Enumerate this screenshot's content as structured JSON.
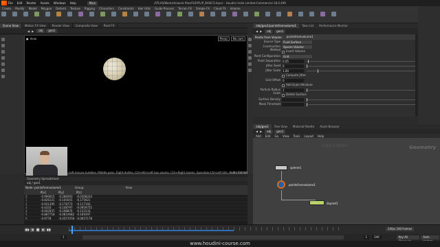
{
  "window": {
    "title": "/ATLAS/Work/sfx/work files/FLIP/FLIP_BASICS.hipnc - Houdini Indie Limited-Commercial 18.0.499",
    "menu": [
      "File",
      "Edit",
      "Render",
      "Assets",
      "Windows",
      "Help"
    ],
    "desktop": "Main"
  },
  "shelf": {
    "tabs": [
      "Create",
      "Modify",
      "Model",
      "Polygon",
      "Deform",
      "Texture",
      "Rigging",
      "Characters",
      "Constraints",
      "Hair Utils",
      "Guide Process",
      "Terrain FX",
      "Simple FX",
      "Cloud FX",
      "Volume"
    ]
  },
  "left_tabs": [
    "Scene View",
    "Motion FX View",
    "Render View",
    "Composite View",
    "Pixel FX"
  ],
  "left_path": [
    "obj",
    "geo1"
  ],
  "viewport": {
    "label": "View",
    "persp": "Persp",
    "cam": "No cam",
    "status": "Left mouse tumbles. Middle pans. Right dollies. Ctrl+Alt+Left box zooms. Ctrl+Right zooms. Spacebar-Ctrl-Left tilts. Hold L for alternate tumble, dolly, and zoom.",
    "indie": "Indie Edition"
  },
  "spreadsheet": {
    "tabs": [
      "Geometry Spreadsheet"
    ],
    "path": "obj / geo1",
    "node": "Node: pointsfromvolume1",
    "group_label": "Group:",
    "view_label": "View",
    "columns": [
      "",
      "P[x]",
      "P[y]",
      "P[z]"
    ],
    "rows": [
      [
        "0",
        "-0.999015",
        "-0.286093",
        "-0.0308224"
      ],
      [
        "1",
        "-0.826121",
        "-0.105055",
        "-0.175921"
      ],
      [
        "2",
        "-0.931395",
        "-0.178773",
        "-0.117193"
      ],
      [
        "3",
        "-0.4333",
        "-0.148797",
        "-0.0959755"
      ],
      [
        "4",
        "-0.942937",
        "-0.198876",
        "-0.133133"
      ],
      [
        "5",
        "-0.887718",
        "-0.0810682",
        "-0.169397"
      ],
      [
        "6",
        "-0.9778",
        "-0.0557078",
        "-0.0657178"
      ]
    ]
  },
  "timeline": {
    "buttons": [
      "◀◀",
      "◀",
      "■",
      "▶",
      "▶▶"
    ],
    "frame": "1",
    "start": "1",
    "end": "240",
    "range_start": "1",
    "range_end": "240",
    "fps_label": "24fps 240 frames",
    "channels": "Key All Channels",
    "auto_update": "Auto Update"
  },
  "watermark": "www.houdini-course.com",
  "params": {
    "tabs": [
      "/obj/geo1/pointsfromvolume1",
      "Take List",
      "Performance Monitor"
    ],
    "path": [
      "obj",
      "geo1"
    ],
    "node_type": "Points from Volume",
    "node_name": "pointsfromvolume1",
    "fields": [
      {
        "label": "Source Type",
        "kind": "dropdown",
        "value": "Fluid Surface"
      },
      {
        "label": "Construction Method",
        "kind": "dropdown",
        "value": "Sparse Volume"
      },
      {
        "label": "",
        "kind": "check",
        "value": "Invert Volume"
      },
      {
        "label": "Point Configuration",
        "kind": "dropdown",
        "value": "Grid"
      },
      {
        "label": "Point Separation",
        "kind": "num",
        "value": "0.05",
        "pos": 0.01
      },
      {
        "label": "Jitter Seed",
        "kind": "num",
        "value": "0",
        "pos": 0.0
      },
      {
        "label": "Jitter Scale",
        "kind": "num",
        "value": "1.00",
        "pos": 0.1
      },
      {
        "label": "",
        "kind": "check",
        "value": "Compute Jitter"
      },
      {
        "label": "Grid Offset",
        "kind": "vec",
        "value": "0"
      },
      {
        "label": "",
        "kind": "check",
        "value": "Add Scale Attribute"
      },
      {
        "label": "Particle Radius Scale",
        "kind": "num",
        "value": "1",
        "pos": 0.0
      },
      {
        "label": "",
        "kind": "check",
        "value": "Delete Surface"
      },
      {
        "label": "Surface Density",
        "kind": "num",
        "value": "",
        "pos": 0.0
      },
      {
        "label": "Mask Threshold",
        "kind": "num",
        "value": "",
        "pos": 0.0
      }
    ]
  },
  "network": {
    "tabs": [
      "/obj/geo1",
      "Tree View",
      "Material Palette",
      "Asset Browser"
    ],
    "path": [
      "obj",
      "geo1"
    ],
    "menu": [
      "Add",
      "Edit",
      "Go",
      "View",
      "Tools",
      "Layout",
      "Help"
    ],
    "context": "Geometry",
    "ghost": "Indie Edition",
    "nodes": [
      {
        "name": "sphere1",
        "color": "#c8c8c8"
      },
      {
        "name": "pointsfromvolume1",
        "color": "#2a5fa8"
      },
      {
        "name": "dopnet1",
        "color": "#b9d26a"
      }
    ]
  },
  "colors": {
    "accent": "#ff7a00",
    "cache": "#2f6fb8",
    "viewport": "#000000",
    "network_bg": "#404040"
  }
}
